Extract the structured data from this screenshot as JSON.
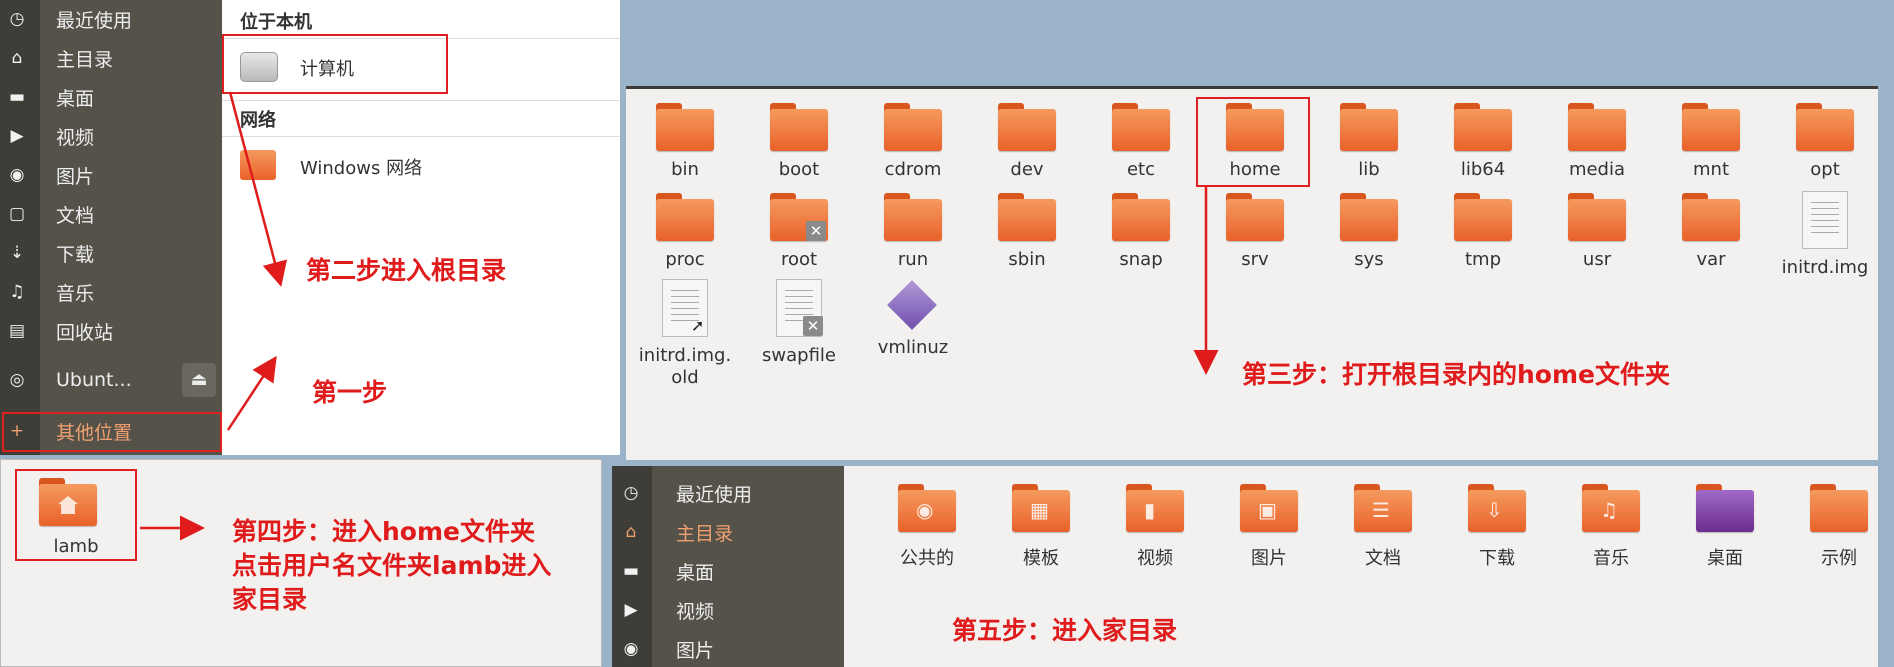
{
  "sidebar1": {
    "items": [
      {
        "icon": "clock-icon",
        "glyph": "◷",
        "label": "最近使用"
      },
      {
        "icon": "home-icon",
        "glyph": "⌂",
        "label": "主目录"
      },
      {
        "icon": "folder-icon",
        "glyph": "▬",
        "label": "桌面"
      },
      {
        "icon": "video-icon",
        "glyph": "▶",
        "label": "视频"
      },
      {
        "icon": "camera-icon",
        "glyph": "◉",
        "label": "图片"
      },
      {
        "icon": "document-icon",
        "glyph": "▢",
        "label": "文档"
      },
      {
        "icon": "download-icon",
        "glyph": "⇣",
        "label": "下载"
      },
      {
        "icon": "music-icon",
        "glyph": "♫",
        "label": "音乐"
      },
      {
        "icon": "trash-icon",
        "glyph": "▤",
        "label": "回收站"
      },
      {
        "icon": "disc-icon",
        "glyph": "◎",
        "label": "Ubunt..."
      },
      {
        "icon": "plus-icon",
        "glyph": "+",
        "label": "其他位置"
      }
    ]
  },
  "locations": {
    "on_this_computer": "位于本机",
    "computer": "计算机",
    "network": "网络",
    "windows_network": "Windows 网络"
  },
  "root_files": [
    "bin",
    "boot",
    "cdrom",
    "dev",
    "etc",
    "home",
    "lib",
    "lib64",
    "media",
    "mnt",
    "opt",
    "proc",
    "root",
    "run",
    "sbin",
    "snap",
    "srv",
    "sys",
    "tmp",
    "usr",
    "var",
    "initrd.img",
    "initrd.img.\nold",
    "swapfile",
    "vmlinuz"
  ],
  "home_panel": {
    "user_folder": "lamb"
  },
  "sidebar2": {
    "items": [
      {
        "icon": "clock-icon",
        "glyph": "◷",
        "label": "最近使用"
      },
      {
        "icon": "home-icon",
        "glyph": "⌂",
        "label": "主目录"
      },
      {
        "icon": "folder-icon",
        "glyph": "▬",
        "label": "桌面"
      },
      {
        "icon": "video-icon",
        "glyph": "▶",
        "label": "视频"
      },
      {
        "icon": "camera-icon",
        "glyph": "◉",
        "label": "图片"
      }
    ]
  },
  "home_files": [
    "公共的",
    "模板",
    "视频",
    "图片",
    "文档",
    "下载",
    "音乐",
    "桌面",
    "示例"
  ],
  "annotations": {
    "step1": "第一步",
    "step2": "第二步进入根目录",
    "step3": "第三步：打开根目录内的home文件夹",
    "step4": "第四步：进入home文件夹\n点击用户名文件夹lamb进入\n家目录",
    "step5": "第五步：进入家目录"
  },
  "colors": {
    "annotation": "#e01b1b",
    "folder": "#ee7a3c",
    "sidebar": "#55524a",
    "accent": "#e95420"
  }
}
